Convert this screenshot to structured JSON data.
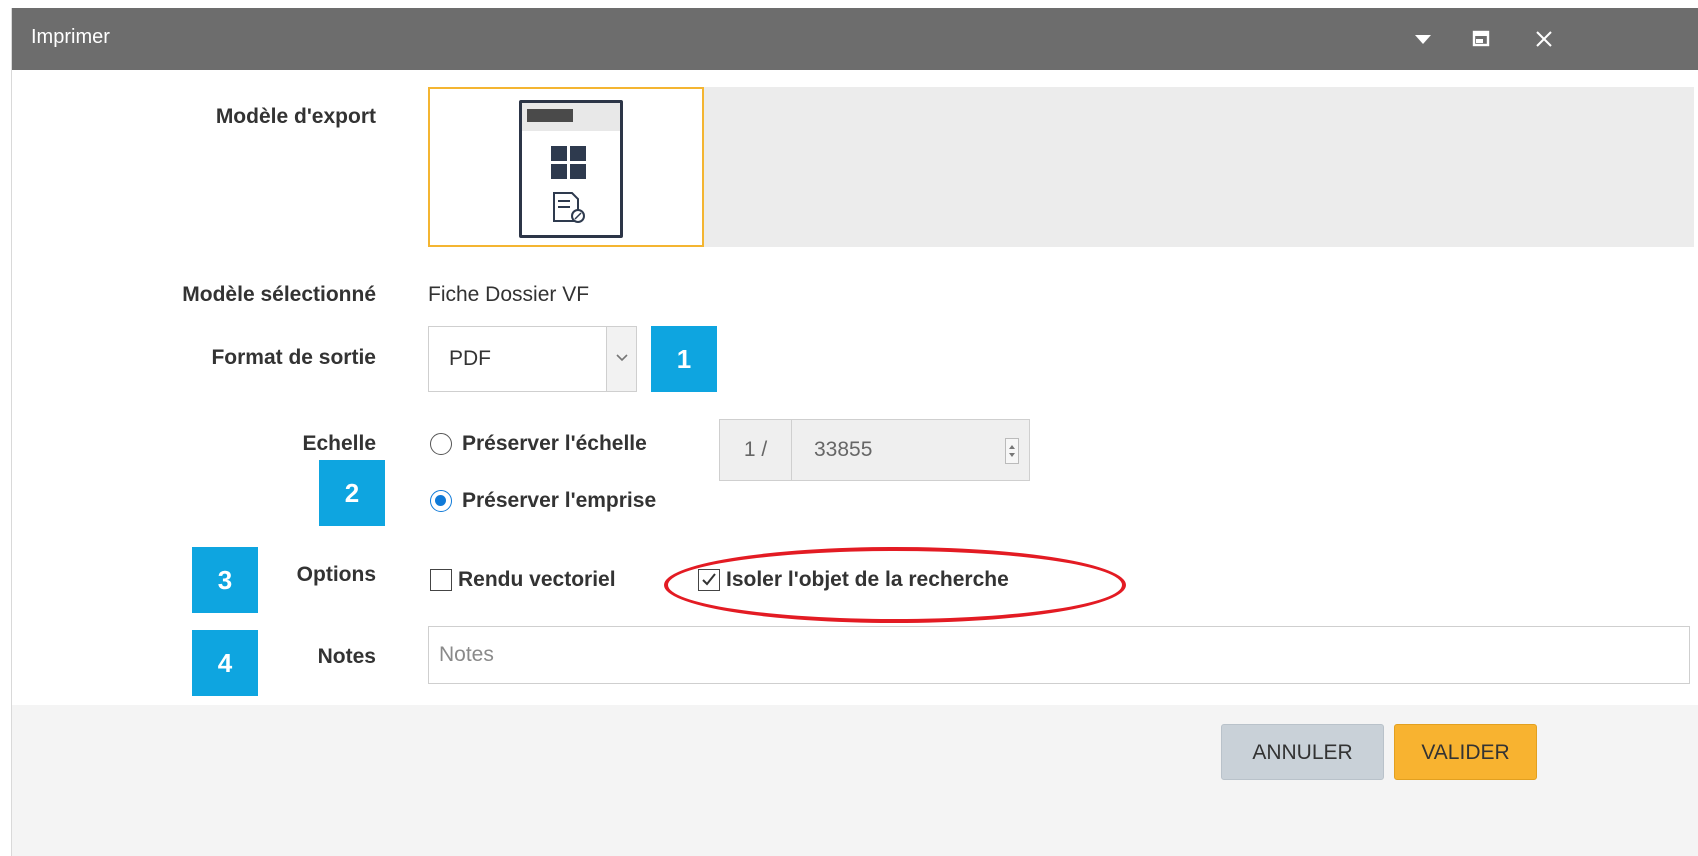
{
  "window": {
    "title": "Imprimer",
    "controls": [
      "dropdown-icon",
      "restore-icon",
      "close-icon"
    ]
  },
  "form": {
    "export_template": {
      "label": "Modèle d'export",
      "selected_card_icon": "template-thumbnail-icon"
    },
    "selected_template": {
      "label": "Modèle sélectionné",
      "value": "Fiche Dossier VF"
    },
    "output_format": {
      "label": "Format de sortie",
      "value": "PDF"
    },
    "scale": {
      "label": "Echelle",
      "preserve_scale_label": "Préserver l'échelle",
      "preserve_extent_label": "Préserver l'emprise",
      "selected": "preserve_extent",
      "prefix": "1 /",
      "value": "33855"
    },
    "options": {
      "label": "Options",
      "vector_render_label": "Rendu vectoriel",
      "vector_render_checked": false,
      "isolate_label": "Isoler l'objet de la recherche",
      "isolate_checked": true
    },
    "notes": {
      "label": "Notes",
      "placeholder": "Notes",
      "value": ""
    }
  },
  "callouts": [
    "1",
    "2",
    "3",
    "4"
  ],
  "buttons": {
    "cancel": "ANNULER",
    "submit": "VALIDER"
  },
  "colors": {
    "titlebar": "#6d6d6d",
    "accent_selected": "#f4b531",
    "callout": "#0ea5e0",
    "highlight": "#e31b23",
    "radio_checked": "#0f7ad8",
    "submit_button": "#f8b330",
    "cancel_button": "#c9d1d8"
  }
}
